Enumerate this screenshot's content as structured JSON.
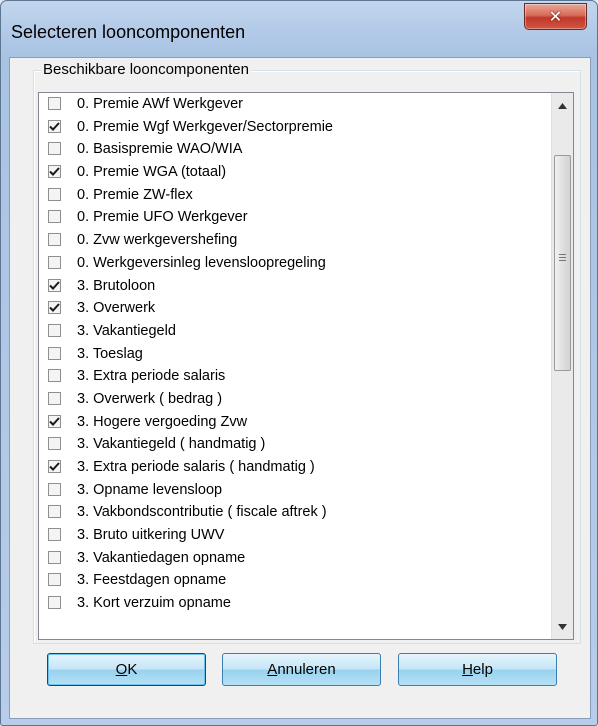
{
  "window": {
    "title": "Selecteren looncomponenten"
  },
  "group": {
    "legend": "Beschikbare looncomponenten"
  },
  "items": [
    {
      "label": "0. Premie AWf Werkgever",
      "checked": false
    },
    {
      "label": "0. Premie Wgf Werkgever/Sectorpremie",
      "checked": true
    },
    {
      "label": "0. Basispremie WAO/WIA",
      "checked": false
    },
    {
      "label": "0. Premie WGA (totaal)",
      "checked": true
    },
    {
      "label": "0. Premie ZW-flex",
      "checked": false
    },
    {
      "label": "0. Premie UFO Werkgever",
      "checked": false
    },
    {
      "label": "0. Zvw werkgevershefing",
      "checked": false
    },
    {
      "label": "0. Werkgeversinleg levensloopregeling",
      "checked": false
    },
    {
      "label": "3. Brutoloon",
      "checked": true
    },
    {
      "label": "3. Overwerk",
      "checked": true
    },
    {
      "label": "3. Vakantiegeld",
      "checked": false
    },
    {
      "label": "3. Toeslag",
      "checked": false
    },
    {
      "label": "3. Extra periode salaris",
      "checked": false
    },
    {
      "label": "3. Overwerk ( bedrag )",
      "checked": false
    },
    {
      "label": "3. Hogere vergoeding Zvw",
      "checked": true
    },
    {
      "label": "3. Vakantiegeld ( handmatig )",
      "checked": false
    },
    {
      "label": "3. Extra periode salaris ( handmatig )",
      "checked": true
    },
    {
      "label": "3. Opname levensloop",
      "checked": false
    },
    {
      "label": "3. Vakbondscontributie ( fiscale aftrek )",
      "checked": false
    },
    {
      "label": "3. Bruto uitkering UWV",
      "checked": false
    },
    {
      "label": "3. Vakantiedagen opname",
      "checked": false
    },
    {
      "label": "3. Feestdagen opname",
      "checked": false
    },
    {
      "label": "3. Kort verzuim opname",
      "checked": false
    }
  ],
  "buttons": {
    "ok": {
      "accel": "O",
      "rest": "K"
    },
    "cancel": {
      "accel": "A",
      "rest": "nnuleren"
    },
    "help": {
      "accel": "H",
      "rest": "elp"
    }
  },
  "icons": {
    "close": "close-icon",
    "check": "checkmark-icon",
    "scroll_up": "scroll-up-arrow-icon",
    "scroll_down": "scroll-down-arrow-icon"
  }
}
